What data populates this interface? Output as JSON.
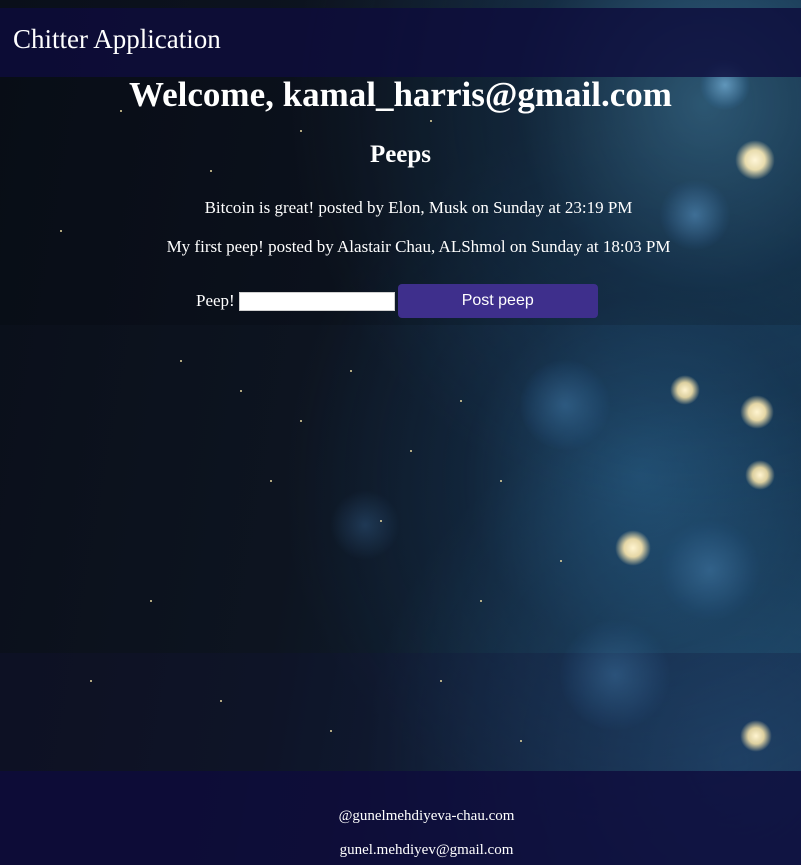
{
  "header": {
    "title": "Chitter Application"
  },
  "main": {
    "welcome_prefix": "Welcome, ",
    "user_email": "kamal_harris@gmail.com",
    "peeps_heading": "Peeps",
    "peeps": [
      {
        "text": "Bitcoin is great!",
        "posted_by": "posted by",
        "author": "Elon, Musk",
        "on": "on",
        "day": "Sunday",
        "at": "at",
        "time": "23:19 PM"
      },
      {
        "text": "My first peep!",
        "posted_by": "posted by",
        "author": "Alastair Chau, ALShmol",
        "on": "on",
        "day": "Sunday",
        "at": "at",
        "time": "18:03 PM"
      }
    ],
    "form": {
      "label": "Peep!",
      "input_value": "",
      "button_label": "Post peep"
    }
  },
  "footer": {
    "handle": "@gunelmehdiyeva-chau.com",
    "email": "gunel.mehdiyev@gmail.com"
  },
  "colors": {
    "bar_background": "#0e0c3c",
    "button_background": "#3e2f8c",
    "text": "#ffffff"
  }
}
